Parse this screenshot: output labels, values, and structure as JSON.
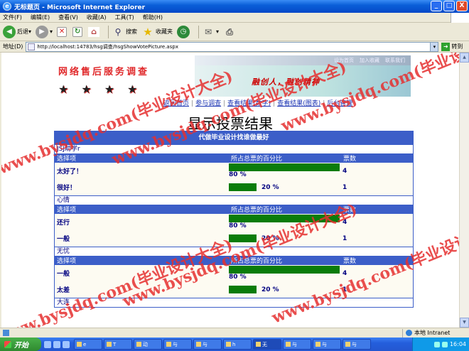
{
  "window": {
    "title": "无标题页 - Microsoft Internet Explorer",
    "controls": [
      "_",
      "□",
      "X"
    ]
  },
  "menu": [
    "文件(F)",
    "编辑(E)",
    "查看(V)",
    "收藏(A)",
    "工具(T)",
    "帮助(H)"
  ],
  "toolbar": {
    "back": "后退",
    "search": "搜索",
    "favorites": "收藏夹"
  },
  "address": {
    "label": "地址(D)",
    "url": "http://localhost:14783/hsg调查/hsgShowVotePicture.aspx",
    "go": "转到"
  },
  "site": {
    "title": "网络售后服务调查",
    "banner_links": [
      "设为首页",
      "加入收藏",
      "联系我们"
    ],
    "banner_slogan": "融创人，融创精神",
    "nav": [
      "返回首页",
      "参与调查",
      "查看结果(数字)",
      "查看结果(图表)",
      "后台管理"
    ]
  },
  "page": {
    "heading": "显示投票结果"
  },
  "results": {
    "header": "代做毕业设计找谁做最好",
    "columns": [
      "选择项",
      "所占总票的百分比",
      "票数"
    ],
    "polls": [
      {
        "name": "JSJ助学r",
        "options": [
          {
            "label": "太好了！",
            "percent_text": "80 %",
            "percent": 0.8,
            "votes": "4"
          },
          {
            "label": "很好！",
            "percent_text": "20 %",
            "percent": 0.2,
            "votes": "1"
          }
        ]
      },
      {
        "name": "心情",
        "options": [
          {
            "label": "还行",
            "percent_text": "80 %",
            "percent": 0.8,
            "votes": "4"
          },
          {
            "label": "一般",
            "percent_text": "20 %",
            "percent": 0.2,
            "votes": "1"
          }
        ]
      },
      {
        "name": "无忧",
        "options": [
          {
            "label": "一般",
            "percent_text": "80 %",
            "percent": 0.8,
            "votes": "4"
          },
          {
            "label": "太差",
            "percent_text": "20 %",
            "percent": 0.2,
            "votes": "1"
          }
        ]
      },
      {
        "name": "大连",
        "options": []
      }
    ]
  },
  "watermark": [
    "www.bysjdq.com(毕业设计大全)",
    "www.bysjdq.com(毕业设计大全)",
    "www.bysjdq.com(毕业设计大全)",
    "www.bysjdq.com(毕业设计大全)",
    "www.bysjdq.com(毕业设计大全)",
    "www.bysjdq.com(毕业设计大全)"
  ],
  "status": {
    "zone": "本地 Intranet"
  },
  "taskbar": {
    "start": "开始",
    "tasks": [
      "e",
      "T",
      "动",
      "与",
      "与",
      "h",
      "无",
      "与",
      "与",
      "与"
    ],
    "clock": "16:04"
  },
  "colors": {
    "accent": "#3c5ec8",
    "bar": "#0a7c0a",
    "title_red": "#e0282a",
    "link": "#1a33b3"
  }
}
